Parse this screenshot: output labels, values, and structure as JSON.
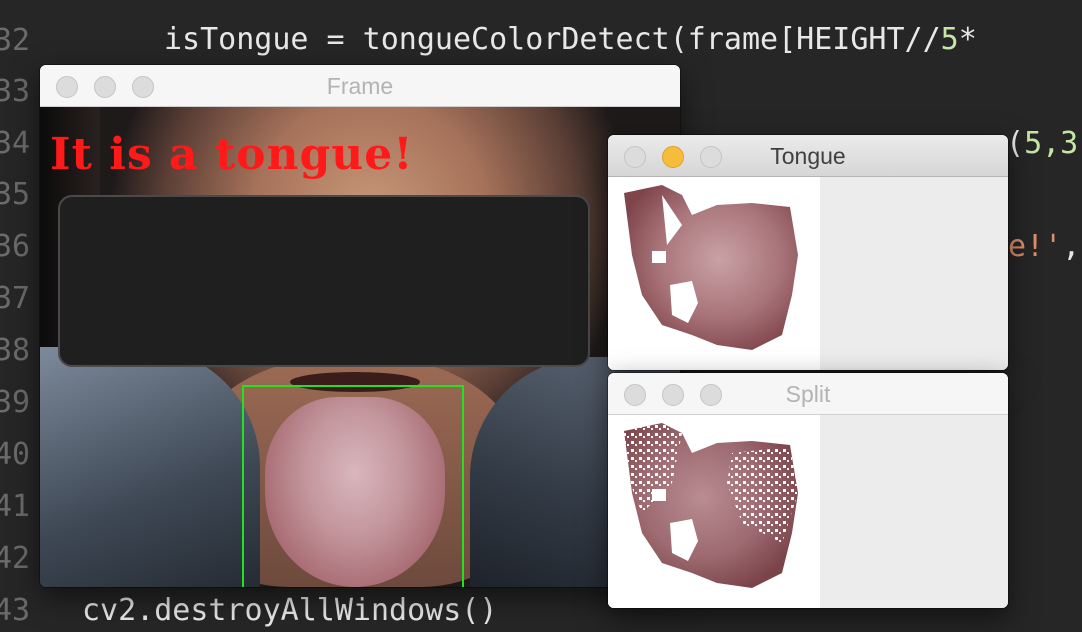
{
  "editor": {
    "line_numbers": [
      "32",
      "33",
      "34",
      "35",
      "36",
      "37",
      "38",
      "39",
      "40",
      "41",
      "42",
      "43"
    ],
    "line_32_pre": "isTongue = tongueColorDetect(frame[HEIGHT//",
    "line_32_num": "5",
    "line_32_post": "*",
    "line_34_frag_fn": "(",
    "line_34_frag_nums": "5,3",
    "line_36_frag_str": "e!'",
    "line_36_frag_tail": ",",
    "line_43_code": "cv2.destroyAllWindows()"
  },
  "windows": {
    "frame": {
      "title": "Frame",
      "status_text": "It is a tongue!"
    },
    "tongue": {
      "title": "Tongue"
    },
    "split": {
      "title": "Split"
    }
  },
  "colors": {
    "status_text": "#ff1a1a",
    "detect_box": "#22e022",
    "yellow_light": "#f6bd3a"
  },
  "icons": [
    "close-light-icon",
    "minimize-light-icon",
    "zoom-light-icon"
  ]
}
